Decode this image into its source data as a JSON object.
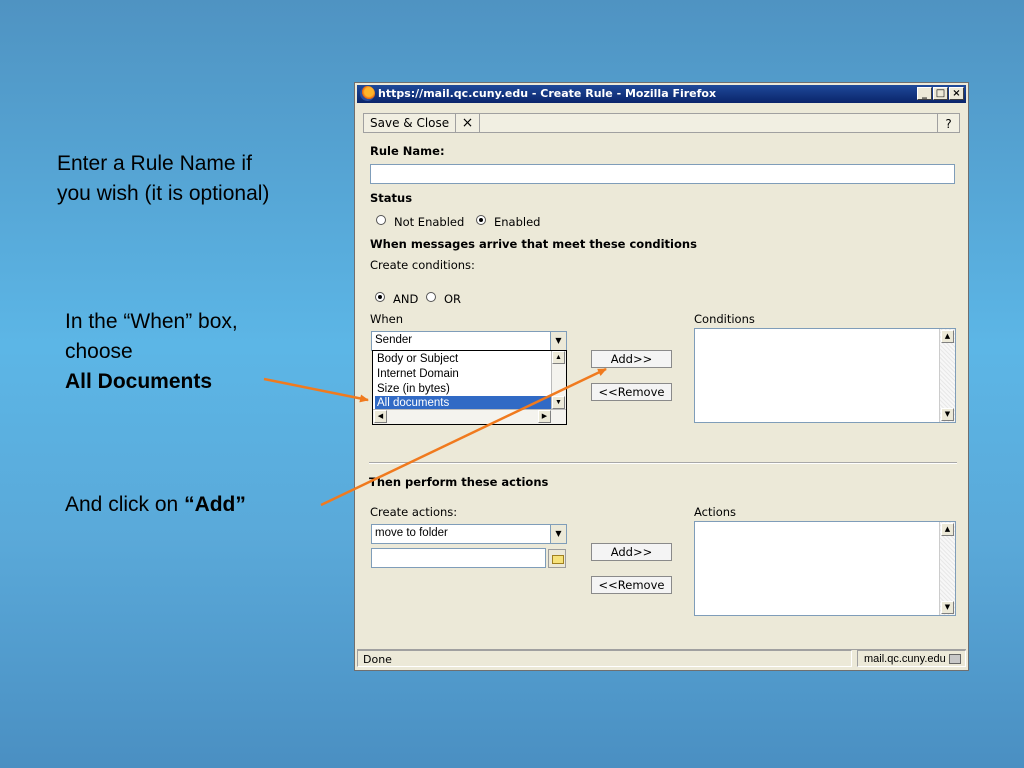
{
  "slide": {
    "note1_line1": "Enter a Rule Name if",
    "note1_line2": "you wish (it is optional)",
    "note2_line1": "In the “When” box,",
    "note2_line2": "choose",
    "note2_line3": "All Documents",
    "note3_prefix": "And click on ",
    "note3_bold": "“Add”",
    "arrow_color": "#f07a1e"
  },
  "window": {
    "title": "https://mail.qc.cuny.edu - Create Rule - Mozilla Firefox",
    "minimize": "_",
    "maximize": "□",
    "close": "×"
  },
  "toolbar": {
    "save_close": "Save & Close",
    "close_icon": "×",
    "help": "?"
  },
  "form": {
    "rule_name_label": "Rule Name:",
    "rule_name_value": "",
    "status_label": "Status",
    "status_options": [
      "Not Enabled",
      "Enabled"
    ],
    "status_selected": "Enabled",
    "conditions_heading": "When messages arrive that meet these conditions",
    "create_conditions": "Create conditions:",
    "logic_options": [
      "AND",
      "OR"
    ],
    "logic_selected": "AND",
    "when_label": "When",
    "when_selected": "Sender",
    "when_list": [
      "Body or Subject",
      "Internet Domain",
      "Size (in bytes)",
      "All documents"
    ],
    "when_list_highlighted": "All documents",
    "conditions_label": "Conditions",
    "add_cond": "Add>>",
    "remove_cond": "<<Remove",
    "actions_heading": "Then perform these actions",
    "create_actions": "Create actions:",
    "actions_selected": "move to folder",
    "folder_value": "",
    "actions_label": "Actions",
    "add_action": "Add>>",
    "remove_action": "<<Remove"
  },
  "statusbar": {
    "status": "Done",
    "host": "mail.qc.cuny.edu"
  }
}
